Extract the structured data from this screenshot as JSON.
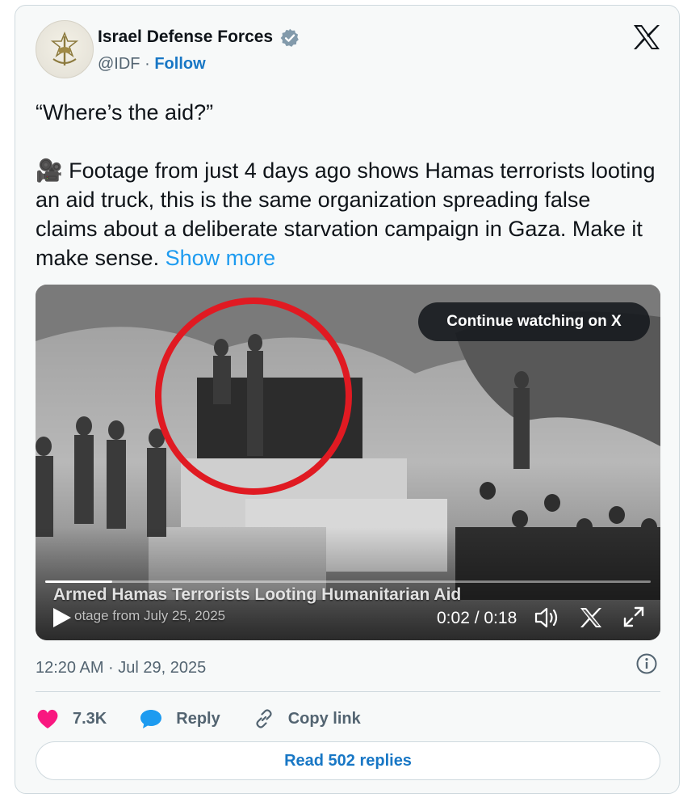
{
  "author": {
    "name": "Israel Defense Forces",
    "handle": "@IDF",
    "separator": "·",
    "follow_label": "Follow"
  },
  "tweet": {
    "line1": "“Where’s the aid?”",
    "body_emoji": "🎥",
    "body": "Footage from just 4 days ago shows Hamas terrorists looting an aid truck, this is the same organization spreading false claims about a deliberate starvation campaign in Gaza. Make it make sense.",
    "show_more": "Show more"
  },
  "video": {
    "continue_label": "Continue watching on X",
    "caption_title": "Armed Hamas Terrorists Looting Humanitarian Aid",
    "caption_subtitle": "otage from July 25, 2025",
    "time": "0:02 / 0:18",
    "progress": 0.11
  },
  "meta": {
    "timestamp": "12:20 AM · Jul 29, 2025"
  },
  "actions": {
    "likes": "7.3K",
    "reply": "Reply",
    "copy_link": "Copy link"
  },
  "read_replies": "Read 502 replies",
  "colors": {
    "accent": "#1d9bf0",
    "like": "#f91880",
    "reply_icon": "#1d9bf0"
  }
}
